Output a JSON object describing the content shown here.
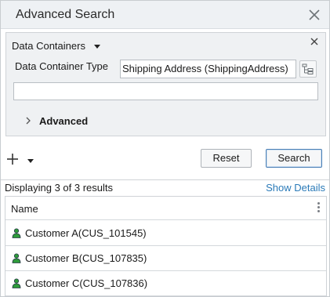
{
  "window": {
    "title": "Advanced Search",
    "close_icon": "close-icon"
  },
  "filter": {
    "data_containers_label": "Data Containers",
    "data_container_type_label": "Data Container Type",
    "data_container_type_value": "Shipping Address (ShippingAddress)",
    "text_field_value": "",
    "advanced_label": "Advanced"
  },
  "toolbar": {
    "reset_label": "Reset",
    "search_label": "Search"
  },
  "results": {
    "count_text": "Displaying 3 of 3 results",
    "show_details_label": "Show Details",
    "column_name": "Name",
    "rows": [
      {
        "label": "Customer A(CUS_101545)"
      },
      {
        "label": "Customer B(CUS_107835)"
      },
      {
        "label": "Customer C(CUS_107836)"
      }
    ]
  },
  "colors": {
    "accent_link": "#2a7ab8",
    "user_icon_green": "#2e9b3a",
    "user_icon_dark": "#2b3a4a"
  }
}
